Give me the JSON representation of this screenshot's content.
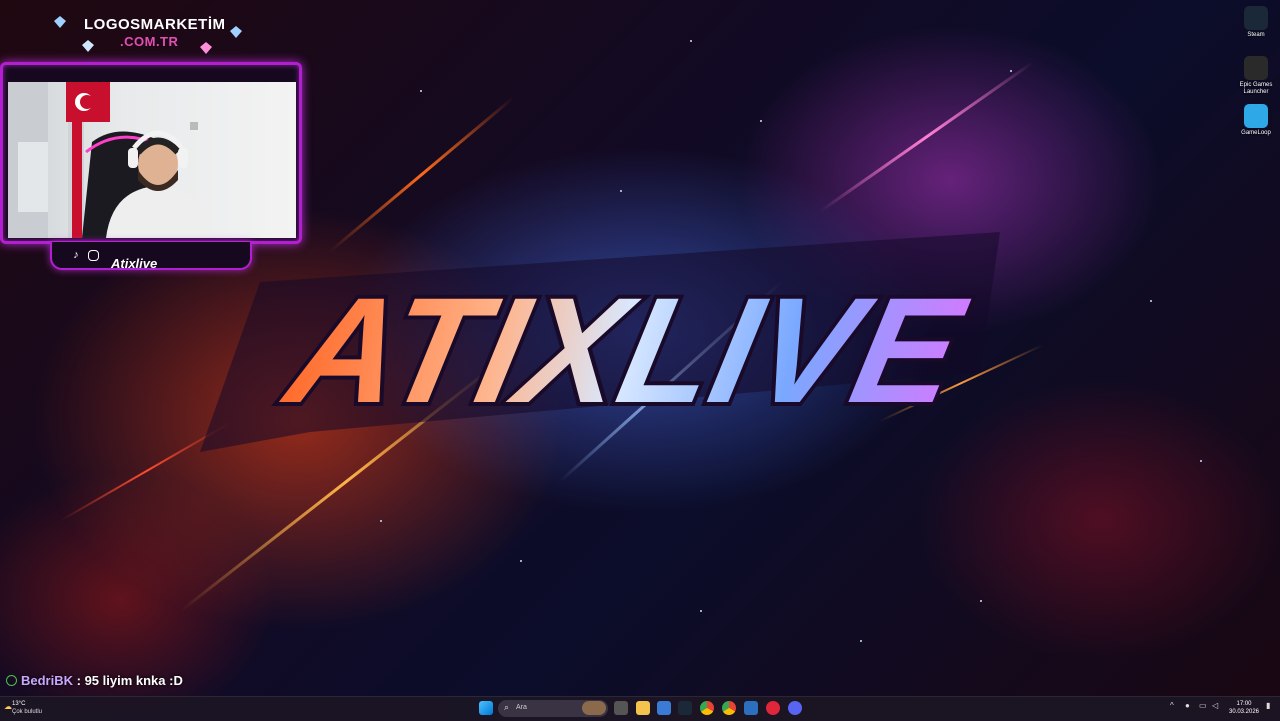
{
  "brand": {
    "line1": "LOGOSMARKETİM",
    "line2": ".COM.TR"
  },
  "stream": {
    "handle": "Atixlive",
    "social_icons": [
      "tiktok-icon",
      "instagram-icon"
    ],
    "tiktok_label": "TikTok"
  },
  "wallpaper": {
    "logo_text": "ATIXLIVE"
  },
  "desktop_icons": [
    {
      "name": "steam",
      "label": "Steam",
      "color": "#1b2838"
    },
    {
      "name": "epic-games-launcher",
      "label": "Epic Games Launcher",
      "color": "#2a2a2a"
    },
    {
      "name": "gameloop",
      "label": "GameLoop",
      "color": "#2fa8e8"
    }
  ],
  "chat": {
    "user": "BedriBK",
    "message": " : 95 liyim knka :D",
    "user_color": "#c8a8ff"
  },
  "taskbar": {
    "weather_temp": "13°C",
    "weather_desc": "Çok bulutlu",
    "search_placeholder": "Ara",
    "apps": [
      "windows-start",
      "search",
      "task-view",
      "file-explorer",
      "microsoft-store",
      "calendar",
      "steam",
      "chrome",
      "chrome-profile",
      "close-app",
      "launcher",
      "discord"
    ],
    "time": "17:00",
    "date": "30.03.2026"
  },
  "colors": {
    "accent": "#b21fd0",
    "taskbar_bg": "#1c1624"
  }
}
